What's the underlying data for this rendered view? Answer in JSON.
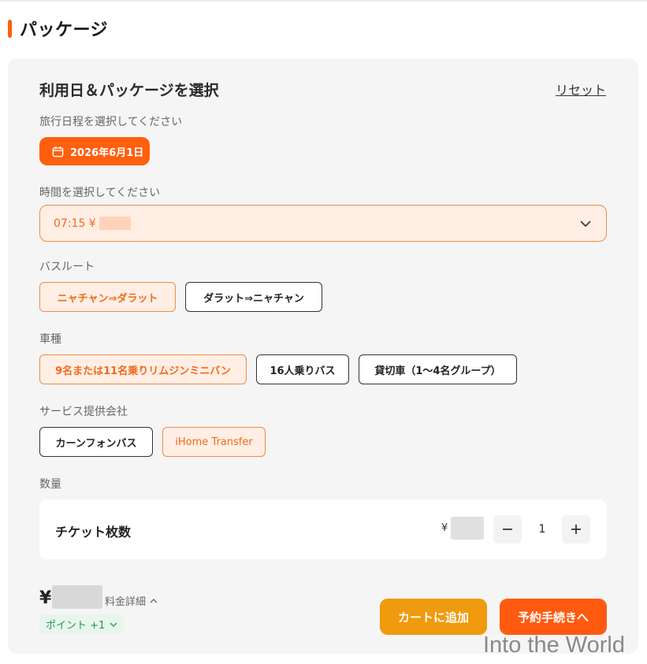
{
  "section_title": "パッケージ",
  "card": {
    "title": "利用日＆パッケージを選択",
    "reset_label": "リセット"
  },
  "date": {
    "label": "旅行日程を選択してください",
    "value": "2026年6月1日"
  },
  "time": {
    "label": "時間を選択してください",
    "value": "07:15 ¥"
  },
  "bus_route": {
    "label": "バスルート",
    "options": [
      {
        "label": "ニャチャン⇒ダラット",
        "selected": true
      },
      {
        "label": "ダラット⇒ニャチャン",
        "selected": false
      }
    ]
  },
  "vehicle": {
    "label": "車種",
    "options": [
      {
        "label": "9名または11名乗りリムジンミニバン",
        "selected": true
      },
      {
        "label": "16人乗りバス",
        "selected": false
      },
      {
        "label": "貸切車（1〜4名グループ）",
        "selected": false
      }
    ]
  },
  "provider": {
    "label": "サービス提供会社",
    "options": [
      {
        "label": "カーンフォンバス",
        "selected": false
      },
      {
        "label": "iHome Transfer",
        "selected": true
      }
    ]
  },
  "quantity": {
    "label": "数量",
    "item_label": "チケット枚数",
    "currency": "¥",
    "value": "1"
  },
  "footer": {
    "currency": "¥",
    "price_detail": "料金詳細",
    "points": "ポイント +1",
    "cart_button": "カートに追加",
    "book_button": "予約手続きへ"
  },
  "watermark": "Into the World",
  "colors": {
    "accent": "#ff5f0f",
    "accent_light": "#ffeee3",
    "cart": "#f09a0d",
    "points_green": "#1e9a4a"
  }
}
